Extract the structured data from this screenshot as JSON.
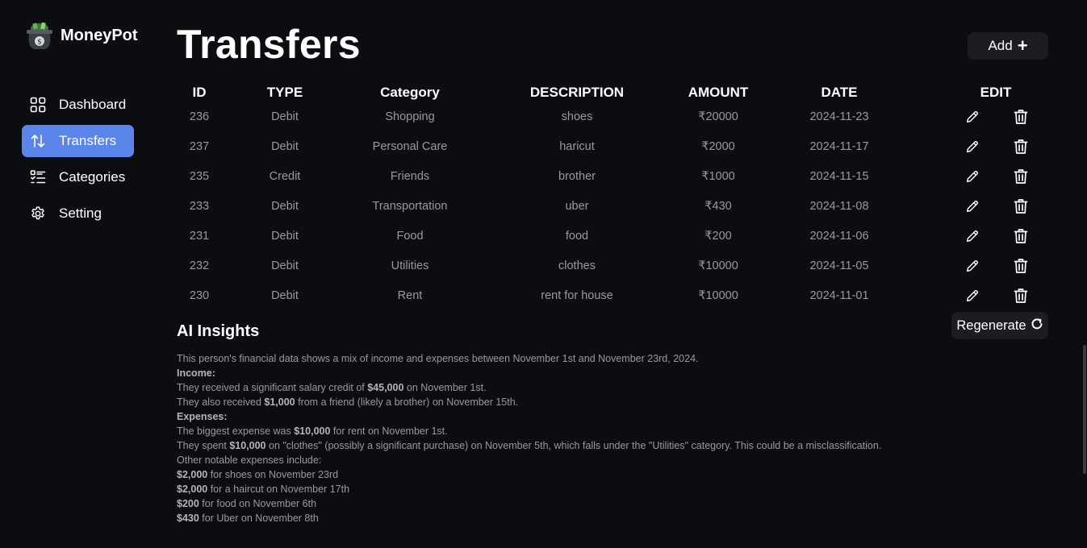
{
  "app": {
    "name": "MoneyPot"
  },
  "sidebar": {
    "items": [
      {
        "label": "Dashboard",
        "icon": "grid-icon",
        "active": false
      },
      {
        "label": "Transfers",
        "icon": "swap-vertical-icon",
        "active": true
      },
      {
        "label": "Categories",
        "icon": "list-icon",
        "active": false
      },
      {
        "label": "Setting",
        "icon": "gear-icon",
        "active": false
      }
    ]
  },
  "colors": {
    "accent": "#5b85ea",
    "background": "#0c0d11",
    "button_bg": "#1b1d22",
    "muted_text": "#9a9a9a"
  },
  "page": {
    "title": "Transfers",
    "add_label": "Add"
  },
  "table": {
    "headers": [
      "ID",
      "TYPE",
      "Category",
      "DESCRIPTION",
      "AMOUNT",
      "DATE",
      "EDIT"
    ],
    "rows": [
      [
        "236",
        "Debit",
        "Shopping",
        "shoes",
        "₹20000",
        "2024-11-23"
      ],
      [
        "237",
        "Debit",
        "Personal Care",
        "haricut",
        "₹2000",
        "2024-11-17"
      ],
      [
        "235",
        "Credit",
        "Friends",
        "brother",
        "₹1000",
        "2024-11-15"
      ],
      [
        "233",
        "Debit",
        "Transportation",
        "uber",
        "₹430",
        "2024-11-08"
      ],
      [
        "231",
        "Debit",
        "Food",
        "food",
        "₹200",
        "2024-11-06"
      ],
      [
        "232",
        "Debit",
        "Utilities",
        "clothes",
        "₹10000",
        "2024-11-05"
      ],
      [
        "230",
        "Debit",
        "Rent",
        "rent for house",
        "₹10000",
        "2024-11-01"
      ]
    ]
  },
  "insights": {
    "title": "AI Insights",
    "regenerate_label": "Regenerate",
    "lines": [
      [
        {
          "t": "This person's financial data shows a mix of income and expenses between November 1st and November 23rd, 2024."
        }
      ],
      [
        {
          "t": "Income:",
          "b": true
        }
      ],
      [
        {
          "t": "They received a significant salary credit of "
        },
        {
          "t": "$45,000",
          "b": true
        },
        {
          "t": " on November 1st."
        }
      ],
      [
        {
          "t": "They also received "
        },
        {
          "t": "$1,000",
          "b": true
        },
        {
          "t": " from a friend (likely a brother) on November 15th."
        }
      ],
      [
        {
          "t": "Expenses:",
          "b": true
        }
      ],
      [
        {
          "t": "The biggest expense was "
        },
        {
          "t": "$10,000",
          "b": true
        },
        {
          "t": " for rent on November 1st."
        }
      ],
      [
        {
          "t": "They spent "
        },
        {
          "t": "$10,000",
          "b": true
        },
        {
          "t": " on \"clothes\" (possibly a significant purchase) on November 5th, which falls under the \"Utilities\" category. This could be a misclassification."
        }
      ],
      [
        {
          "t": "Other notable expenses include:"
        }
      ],
      [
        {
          "t": "$2,000",
          "b": true
        },
        {
          "t": " for shoes on November 23rd"
        }
      ],
      [
        {
          "t": "$2,000",
          "b": true
        },
        {
          "t": " for a haircut on November 17th"
        }
      ],
      [
        {
          "t": "$200",
          "b": true
        },
        {
          "t": " for food on November 6th"
        }
      ],
      [
        {
          "t": "$430",
          "b": true
        },
        {
          "t": " for Uber on November 8th"
        }
      ]
    ]
  }
}
